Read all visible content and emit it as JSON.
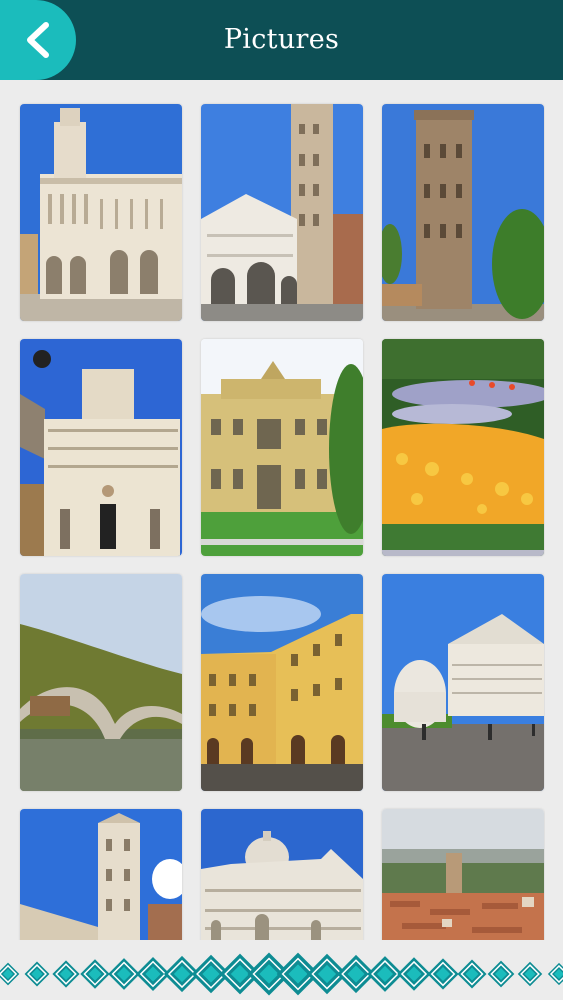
{
  "header": {
    "title": "Pictures",
    "back_icon": "chevron-left-icon",
    "colors": {
      "bar": "#0d4f55",
      "back_button": "#1bbcbc",
      "title": "#ffffff"
    }
  },
  "gallery": {
    "photos": [
      {
        "subject": "church-facade"
      },
      {
        "subject": "cathedral-and-bell-tower"
      },
      {
        "subject": "brick-tower"
      },
      {
        "subject": "church-facade-arcades"
      },
      {
        "subject": "palace-courtyard"
      },
      {
        "subject": "flower-garden"
      },
      {
        "subject": "arched-stone-bridge"
      },
      {
        "subject": "town-square"
      },
      {
        "subject": "cathedral-square"
      },
      {
        "subject": "bell-tower"
      },
      {
        "subject": "cathedral-dome"
      },
      {
        "subject": "rooftop-panorama"
      }
    ]
  },
  "footer": {
    "pattern": "teal-diamond-border",
    "colors": [
      "#0e8c93",
      "#1bbcbc",
      "#ffffff"
    ]
  }
}
